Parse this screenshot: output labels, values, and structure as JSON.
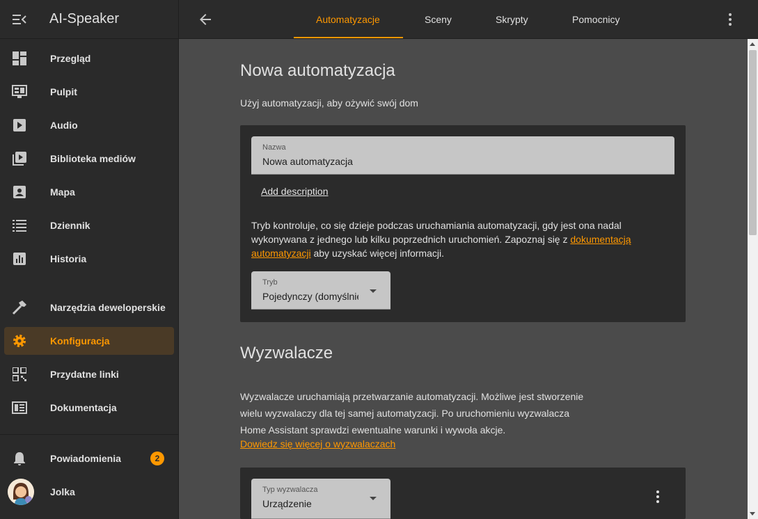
{
  "app": {
    "title": "AI-Speaker"
  },
  "sidebar": {
    "items": [
      {
        "label": "Przegląd",
        "icon": "dashboard-icon"
      },
      {
        "label": "Pulpit",
        "icon": "monitor-dashboard-icon"
      },
      {
        "label": "Audio",
        "icon": "play-box-icon"
      },
      {
        "label": "Biblioteka mediów",
        "icon": "media-library-icon"
      },
      {
        "label": "Mapa",
        "icon": "account-box-icon"
      },
      {
        "label": "Dziennik",
        "icon": "format-list-icon"
      },
      {
        "label": "Historia",
        "icon": "chart-box-icon"
      },
      {
        "label": "Narzędzia deweloperskie",
        "icon": "hammer-icon"
      },
      {
        "label": "Konfiguracja",
        "icon": "cog-icon",
        "active": true
      },
      {
        "label": "Przydatne linki",
        "icon": "qrcode-icon"
      },
      {
        "label": "Dokumentacja",
        "icon": "book-icon"
      }
    ],
    "notifications": {
      "label": "Powiadomienia",
      "count": "2"
    },
    "user": {
      "label": "Jolka"
    }
  },
  "header": {
    "tabs": [
      {
        "label": "Automatyzacje",
        "active": true
      },
      {
        "label": "Sceny"
      },
      {
        "label": "Skrypty"
      },
      {
        "label": "Pomocnicy"
      }
    ]
  },
  "main": {
    "heading": "Nowa automatyzacja",
    "subtitle": "Użyj automatyzacji, aby ożywić swój dom",
    "name_field": {
      "label": "Nazwa",
      "value": "Nowa automatyzacja"
    },
    "add_description": "Add description",
    "mode_text_1": "Tryb kontroluje, co się dzieje podczas uruchamiania automatyzacji, gdy jest ona nadal wykonywana z jednego lub kilku poprzednich uruchomień. Zapoznaj się z ",
    "mode_link": "dokumentacją automatyzacji",
    "mode_text_2": " aby uzyskać więcej informacji.",
    "mode_field": {
      "label": "Tryb",
      "value": "Pojedynczy (domyślnie)"
    },
    "triggers": {
      "heading": "Wyzwalacze",
      "desc_line1": "Wyzwalacze uruchamiają przetwarzanie automatyzacji. Możliwe jest stworzenie",
      "desc_line2": "wielu wyzwalaczy dla tej samej automatyzacji. Po uruchomieniu wyzwalacza",
      "desc_line3": "Home Assistant sprawdzi ewentualne warunki i wywoła akcje.",
      "link": "Dowiedz się więcej o wyzwalaczach",
      "type_field": {
        "label": "Typ wyzwalacza",
        "value": "Urządzenie"
      }
    }
  },
  "colors": {
    "accent": "#ff9800",
    "sidebar_bg": "#2a2a2a",
    "content_bg": "#4b4b4b",
    "card_bg": "#2b2b2b"
  }
}
